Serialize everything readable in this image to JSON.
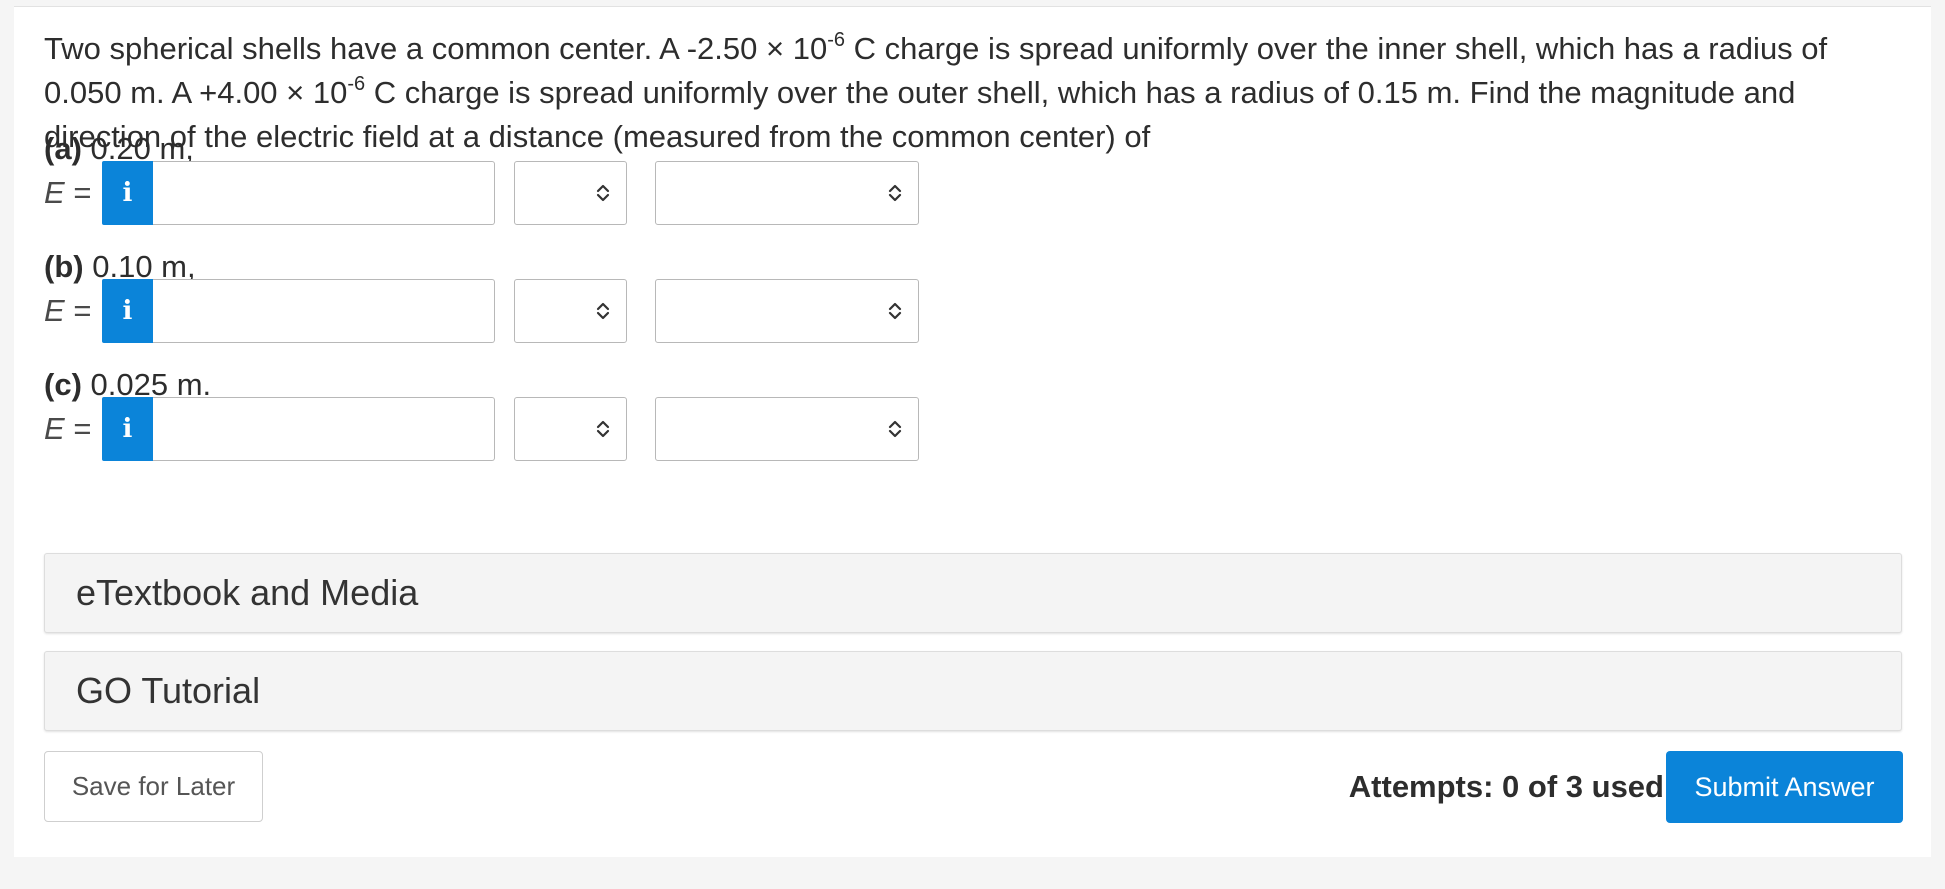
{
  "question": {
    "text_1": "Two spherical shells have a common center. A -2.50 × 10",
    "exp_1": "-6",
    "text_2": " C charge is spread uniformly over the inner shell, which has a radius of 0.050 m. A +4.00 × 10",
    "exp_2": "-6",
    "text_3": " C charge is spread uniformly over the outer shell, which has a radius of 0.15 m. Find the magnitude and direction of the electric field at a distance (measured from the common center) of"
  },
  "parts": [
    {
      "letter": "(a)",
      "distance": "0.20 m,",
      "e_symbol": "E",
      "e_equals": "=",
      "info_icon": "i",
      "value": "",
      "units_selected": "",
      "direction_selected": ""
    },
    {
      "letter": "(b)",
      "distance": "0.10 m,",
      "e_symbol": "E",
      "e_equals": "=",
      "info_icon": "i",
      "value": "",
      "units_selected": "",
      "direction_selected": ""
    },
    {
      "letter": "(c)",
      "distance": "0.025 m.",
      "e_symbol": "E",
      "e_equals": "=",
      "info_icon": "i",
      "value": "",
      "units_selected": "",
      "direction_selected": ""
    }
  ],
  "accordions": {
    "etextbook": "eTextbook and Media",
    "go_tutorial": "GO Tutorial"
  },
  "footer": {
    "save_label": "Save for Later",
    "attempts": "Attempts: 0 of 3 used",
    "submit_label": "Submit Answer"
  },
  "colors": {
    "accent": "#0b84d9",
    "page_bg": "#f5f5f5",
    "accordion_bg": "#f4f4f4"
  },
  "icons": {
    "info": "info-icon",
    "select": "up-down-chevron-icon"
  }
}
